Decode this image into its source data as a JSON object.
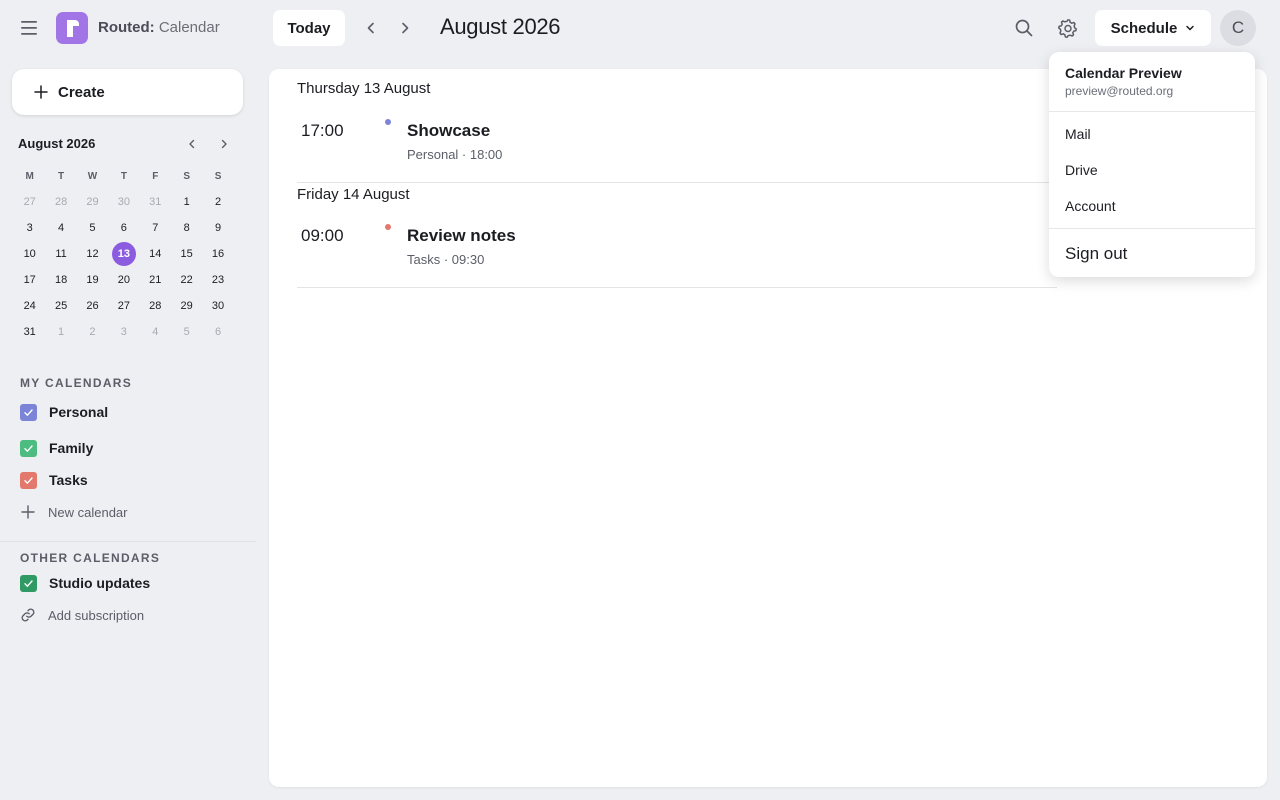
{
  "header": {
    "brand": "Routed:",
    "app": "Calendar",
    "logo_letter": "r",
    "today_label": "Today",
    "period_title": "August 2026",
    "view_label": "Schedule",
    "avatar_initial": "C",
    "icons": [
      "menu-icon",
      "chevron-left-icon",
      "chevron-right-icon",
      "search-icon",
      "gear-icon",
      "chevron-down-icon"
    ]
  },
  "sidebar": {
    "create_label": "Create",
    "mini_calendar": {
      "title": "August 2026",
      "weekdays": [
        "M",
        "T",
        "W",
        "T",
        "F",
        "S",
        "S"
      ],
      "weeks": [
        [
          "27",
          "28",
          "29",
          "30",
          "31",
          "1",
          "2"
        ],
        [
          "3",
          "4",
          "5",
          "6",
          "7",
          "8",
          "9"
        ],
        [
          "10",
          "11",
          "12",
          "13",
          "14",
          "15",
          "16"
        ],
        [
          "17",
          "18",
          "19",
          "20",
          "21",
          "22",
          "23"
        ],
        [
          "24",
          "25",
          "26",
          "27",
          "28",
          "29",
          "30"
        ],
        [
          "31",
          "1",
          "2",
          "3",
          "4",
          "5",
          "6"
        ]
      ],
      "today": "13"
    },
    "my_calendars_label": "MY CALENDARS",
    "my_calendars": [
      {
        "name": "Personal",
        "color": "#7b84d6"
      },
      {
        "name": "Family",
        "color": "#4cbc80"
      },
      {
        "name": "Tasks",
        "color": "#e3786c"
      }
    ],
    "new_calendar_label": "New calendar",
    "other_calendars_label": "OTHER CALENDARS",
    "other_calendars": [
      {
        "name": "Studio updates",
        "color": "#2f9a63"
      }
    ],
    "add_subscription_label": "Add subscription"
  },
  "schedule": {
    "days": [
      {
        "heading": "Thursday 13 August",
        "events": [
          {
            "time": "17:00",
            "title": "Showcase",
            "subtitle": "Personal · 18:00",
            "color": "#7b84d6"
          }
        ]
      },
      {
        "heading": "Friday 14 August",
        "events": [
          {
            "time": "09:00",
            "title": "Review notes",
            "subtitle": "Tasks · 09:30",
            "color": "#e3786c"
          }
        ]
      }
    ]
  },
  "account_menu": {
    "name": "Calendar Preview",
    "email": "preview@routed.org",
    "items": [
      "Mail",
      "Drive",
      "Account"
    ],
    "sign_out": "Sign out"
  }
}
